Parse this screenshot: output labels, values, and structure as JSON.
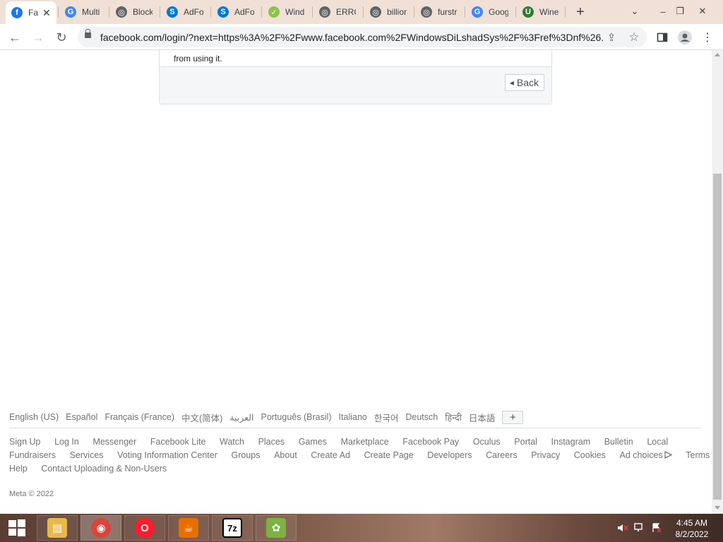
{
  "tabs": [
    {
      "title": "Fa",
      "icon": "facebook-icon",
      "color": "#1877f2",
      "glyph": "f",
      "active": true
    },
    {
      "title": "Multi",
      "icon": "google-icon",
      "color": "#4285f4",
      "glyph": "G"
    },
    {
      "title": "Block",
      "icon": "globe-icon",
      "color": "#5f6368",
      "glyph": "◎"
    },
    {
      "title": "AdFo",
      "icon": "skype-icon",
      "color": "#0078d4",
      "glyph": "S"
    },
    {
      "title": "AdFo",
      "icon": "skype-icon",
      "color": "#0078d4",
      "glyph": "S"
    },
    {
      "title": "Wind",
      "icon": "leaf-icon",
      "color": "#8bc34a",
      "glyph": "✓"
    },
    {
      "title": "ERRO",
      "icon": "globe-icon",
      "color": "#5f6368",
      "glyph": "◎"
    },
    {
      "title": "billion",
      "icon": "globe-icon",
      "color": "#5f6368",
      "glyph": "◎"
    },
    {
      "title": "furstr",
      "icon": "globe-icon",
      "color": "#5f6368",
      "glyph": "◎"
    },
    {
      "title": "Goog",
      "icon": "google-icon",
      "color": "#4285f4",
      "glyph": "G"
    },
    {
      "title": "Wine",
      "icon": "wine-icon",
      "color": "#2e7d32",
      "glyph": "U"
    }
  ],
  "new_tab_glyph": "+",
  "window_controls": {
    "dropdown": "⌄",
    "minimize": "–",
    "restore": "❐",
    "close": "✕"
  },
  "toolbar": {
    "back": "←",
    "forward": "→",
    "reload": "↻",
    "share": "⇪",
    "star": "☆",
    "sidepanel": "▮",
    "profile": "●",
    "menu": "⋮"
  },
  "url": "facebook.com/login/?next=https%3A%2F%2Fwww.facebook.com%2FWindowsDiLshadSys%2F%3Fref%3Dnf%26...",
  "card": {
    "text": "from using it.",
    "back_label": "Back",
    "back_arrow": "◀"
  },
  "languages": [
    "English (US)",
    "Español",
    "Français (France)",
    "中文(简体)",
    "العربية",
    "Português (Brasil)",
    "Italiano",
    "한국어",
    "Deutsch",
    "हिन्दी",
    "日本語"
  ],
  "language_more": "+",
  "footer_links": [
    [
      "Sign Up",
      "Log In",
      "Messenger",
      "Facebook Lite",
      "Watch",
      "Places",
      "Games",
      "Marketplace",
      "Facebook Pay",
      "Oculus",
      "Portal",
      "Instagram",
      "Bulletin",
      "Local"
    ],
    [
      "Fundraisers",
      "Services",
      "Voting Information Center",
      "Groups",
      "About",
      "Create Ad",
      "Create Page",
      "Developers",
      "Careers",
      "Privacy",
      "Cookies",
      "Ad choices",
      "Terms"
    ],
    [
      "Help",
      "Contact Uploading & Non-Users"
    ]
  ],
  "ad_choices_icon": "ad-choices-icon",
  "copyright": "Meta © 2022",
  "taskbar": {
    "apps": [
      {
        "name": "file-explorer",
        "icon": "folder-icon",
        "color": "#e8b84a",
        "glyph": "▤"
      },
      {
        "name": "chrome",
        "icon": "chrome-icon",
        "color": "#db4437",
        "glyph": "◉",
        "active": true
      },
      {
        "name": "opera",
        "icon": "opera-icon",
        "color": "#ff1b2d",
        "glyph": "O"
      },
      {
        "name": "java",
        "icon": "java-icon",
        "color": "#e76f00",
        "glyph": "☕"
      },
      {
        "name": "7zip",
        "icon": "7zip-icon",
        "color": "#000000",
        "glyph": "7z"
      },
      {
        "name": "app",
        "icon": "plant-icon",
        "color": "#7cb342",
        "glyph": "✿"
      }
    ],
    "start_glyph": "⊞",
    "time": "4:45 AM",
    "date": "8/2/2022"
  }
}
